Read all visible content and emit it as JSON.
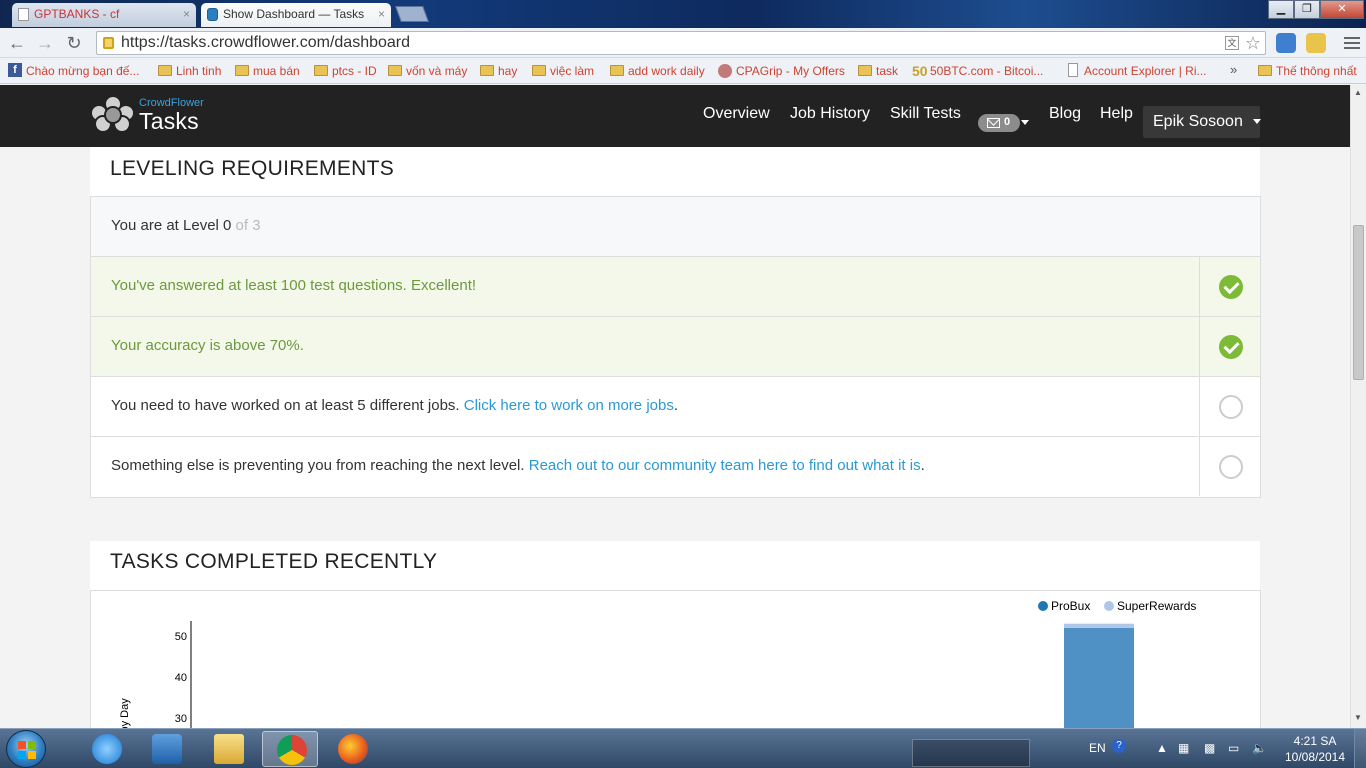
{
  "browser": {
    "tabs": [
      {
        "label": "GPTBANKS - cf",
        "close": "×"
      },
      {
        "label": "Show Dashboard — Tasks",
        "close": "×"
      }
    ],
    "window_controls": {
      "minimize": "▁",
      "maximize": "❐",
      "close": "✕"
    },
    "url": "https://tasks.crowdflower.com/dashboard",
    "bookmarks": [
      {
        "label": "Chào mừng bạn đế...",
        "icon": "facebook-icon"
      },
      {
        "label": "Linh tinh",
        "icon": "folder-icon"
      },
      {
        "label": "mua bán",
        "icon": "folder-icon"
      },
      {
        "label": "ptcs - ID",
        "icon": "folder-icon"
      },
      {
        "label": "vốn và máy",
        "icon": "folder-icon"
      },
      {
        "label": "hay",
        "icon": "folder-icon"
      },
      {
        "label": "việc làm",
        "icon": "folder-icon"
      },
      {
        "label": "add work daily",
        "icon": "folder-icon"
      },
      {
        "label": "CPAGrip - My Offers",
        "icon": "globe-icon"
      },
      {
        "label": "task",
        "icon": "folder-icon"
      },
      {
        "label": "50BTC.com - Bitcoi...",
        "icon": "fifty-icon"
      },
      {
        "label": "Account Explorer | Ri...",
        "icon": "page-icon"
      },
      {
        "label": "Thế thông nhất",
        "icon": "folder-icon"
      }
    ],
    "bookmarks_more": "»"
  },
  "navbar": {
    "brand_small": "CrowdFlower",
    "brand_big": "Tasks",
    "links": [
      "Overview",
      "Job History",
      "Skill Tests",
      "Blog",
      "Help"
    ],
    "message_count": "0",
    "user_name": "Epik Sosoon"
  },
  "leveling": {
    "title": "LEVELING REQUIREMENTS",
    "level_prefix": "You are at Level 0",
    "level_suffix": " of 3",
    "requirements": [
      {
        "text": "You've answered at least 100 test questions. Excellent!",
        "status": "complete"
      },
      {
        "text": "Your accuracy is above 70%.",
        "status": "complete"
      },
      {
        "text": "You need to have worked on at least 5 different jobs. ",
        "link": "Click here to work on more jobs",
        "after": ".",
        "status": "incomplete"
      },
      {
        "text": "Something else is preventing you from reaching the next level. ",
        "link": "Reach out to our community team here to find out what it is",
        "after": ".",
        "status": "incomplete"
      }
    ]
  },
  "tasks": {
    "title": "TASKS COMPLETED RECENTLY"
  },
  "chart_data": {
    "type": "bar",
    "title": "",
    "ylabel": "Tasks by Day",
    "xlabel": "",
    "ylim": [
      20,
      55
    ],
    "yticks": [
      30,
      40,
      50
    ],
    "legend_position": "top-right",
    "series": [
      {
        "name": "ProBux",
        "color": "#1f77b4",
        "values": [
          52
        ]
      },
      {
        "name": "SuperRewards",
        "color": "#aec7e8",
        "values": [
          1
        ]
      }
    ],
    "bar_fill": "#4f91c4"
  },
  "taskbar": {
    "language": "EN",
    "time": "4:21 SA",
    "date": "10/08/2014"
  }
}
